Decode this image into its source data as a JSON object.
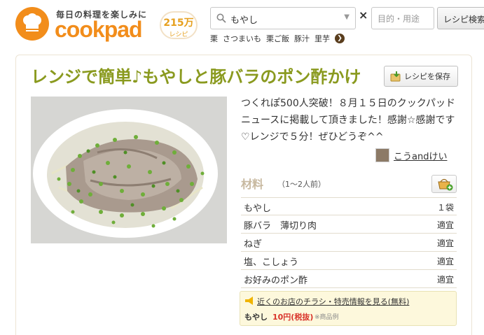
{
  "header": {
    "tagline": "毎日の料理を楽しみに",
    "logo_word": "cookpad",
    "recipe_count": "215万",
    "recipe_count_label": "レシピ",
    "search_value": "もやし",
    "clear_symbol": "×",
    "purpose_placeholder": "目的・用途",
    "search_button_label": "レシピ検索",
    "suggestions": [
      "栗",
      "さつまいも",
      "栗ご飯",
      "豚汁",
      "里芋"
    ],
    "suggest_more_symbol": "❯"
  },
  "recipe": {
    "title": "レンジで簡単♪もやしと豚バラのポン酢かけ",
    "save_label": "レシピを保存",
    "description": "つくれぽ500人突破！８月１５日のクックパッドニュースに掲載して頂きました！感謝☆感謝です♡レンジで５分！ぜひどうぞ^^",
    "author": "こうandけい"
  },
  "ingredients": {
    "heading": "材料",
    "servings": "（1〜2人前）",
    "items": [
      {
        "name": "もやし",
        "qty": "１袋"
      },
      {
        "name": "豚バラ　薄切り肉",
        "qty": "適宜"
      },
      {
        "name": "ねぎ",
        "qty": "適宜"
      },
      {
        "name": "塩、こしょう",
        "qty": "適宜"
      },
      {
        "name": "お好みのポン酢",
        "qty": "適宜"
      }
    ]
  },
  "flyer": {
    "link_text": "近くのお店のチラシ・特売情報を見る(無料)",
    "item": "もやし",
    "price": "10円(税抜)",
    "note": "※商品例"
  },
  "colors": {
    "brand_orange": "#f28d1b",
    "title_green": "#8a9a1f",
    "price_red": "#d9342b"
  }
}
